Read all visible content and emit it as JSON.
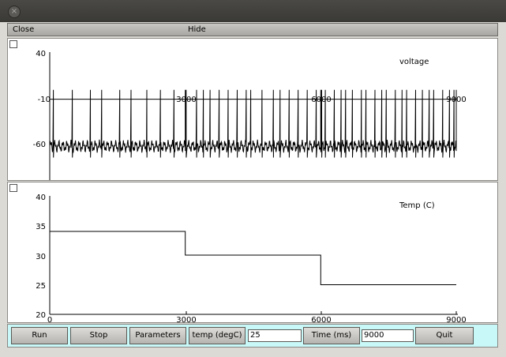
{
  "window": {
    "close_glyph": "×"
  },
  "menu": {
    "close_label": "Close",
    "hide_label": "Hide"
  },
  "voltage_panel": {
    "label": "voltage",
    "y_ticks": [
      "40",
      "-10",
      "-60"
    ],
    "x_ticks": [
      "3000",
      "6000",
      "9000"
    ]
  },
  "temp_panel": {
    "label": "Temp (C)",
    "y_ticks": [
      "40",
      "35",
      "30",
      "25",
      "20"
    ],
    "x_ticks": [
      "0",
      "3000",
      "6000",
      "9000"
    ]
  },
  "controls": {
    "run_label": "Run",
    "stop_label": "Stop",
    "parameters_label": "Parameters",
    "temp_label": "temp (degC)",
    "temp_value": "25",
    "time_label": "Time (ms)",
    "time_value": "9000",
    "quit_label": "Quit"
  },
  "chart_data": [
    {
      "type": "line",
      "ylabel": "voltage",
      "xlim": [
        0,
        9000
      ],
      "ylim": [
        -80,
        40
      ],
      "threshold": -10,
      "baseline": -60,
      "series": [
        {
          "segments": [
            {
              "x_start": 0,
              "x_end": 3000,
              "spike_times": [
                80,
                500,
                900,
                1150,
                1550,
                1800,
                2150,
                2450,
                2750
              ]
            },
            {
              "x_start": 3000,
              "x_end": 6000,
              "spike_times": [
                3020,
                3250,
                3400,
                3550,
                3750,
                3950,
                4150,
                4350,
                4450,
                4700,
                4950,
                5100,
                5300,
                5500,
                5700,
                5900
              ]
            },
            {
              "x_start": 6000,
              "x_end": 9000,
              "spike_times": [
                6020,
                6100,
                6300,
                6450,
                6550,
                6700,
                6900,
                7000,
                7200,
                7350,
                7450,
                7650,
                7800,
                7900,
                8100,
                8250,
                8400,
                8500,
                8700,
                8850,
                8950
              ]
            }
          ]
        }
      ]
    },
    {
      "type": "line",
      "ylabel": "Temp (C)",
      "xlim": [
        0,
        9000
      ],
      "ylim": [
        20,
        40
      ],
      "series": [
        {
          "x": [
            0,
            3000,
            3000,
            6000,
            6000,
            9000
          ],
          "y": [
            34,
            34,
            30,
            30,
            25,
            25
          ]
        }
      ]
    }
  ]
}
